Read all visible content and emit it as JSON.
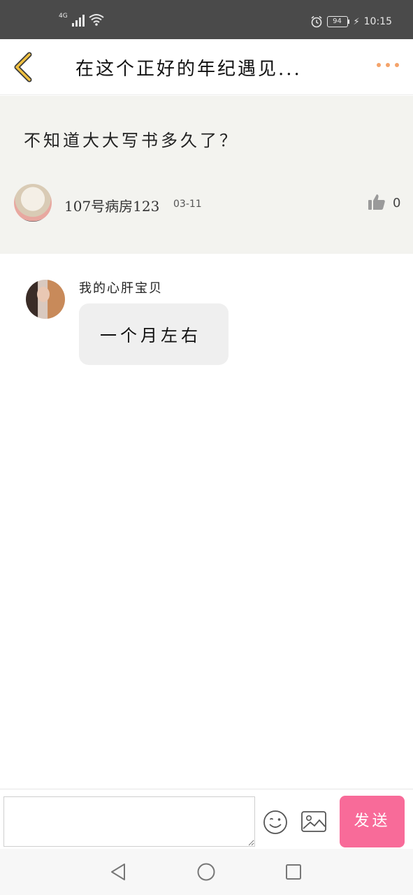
{
  "status_bar": {
    "network": "4G",
    "battery": "94",
    "time": "10:15"
  },
  "header": {
    "title": "在这个正好的年纪遇见...",
    "back_icon": "chevron-left-icon",
    "more_icon": "more-dots-icon"
  },
  "question": {
    "text": "不知道大大写书多久了？",
    "author": "107号病房123",
    "date": "03-11",
    "likes": "0"
  },
  "replies": [
    {
      "name": "我的心肝宝贝",
      "text": "一个月左右"
    }
  ],
  "input_bar": {
    "placeholder": "",
    "send_label": "发送"
  },
  "colors": {
    "accent": "#f86b99",
    "back_chevron": "#f0c040",
    "more_dots": "#f4a36a",
    "question_bg": "#f3f3ef",
    "status_bar_bg": "#4a4a4a"
  }
}
